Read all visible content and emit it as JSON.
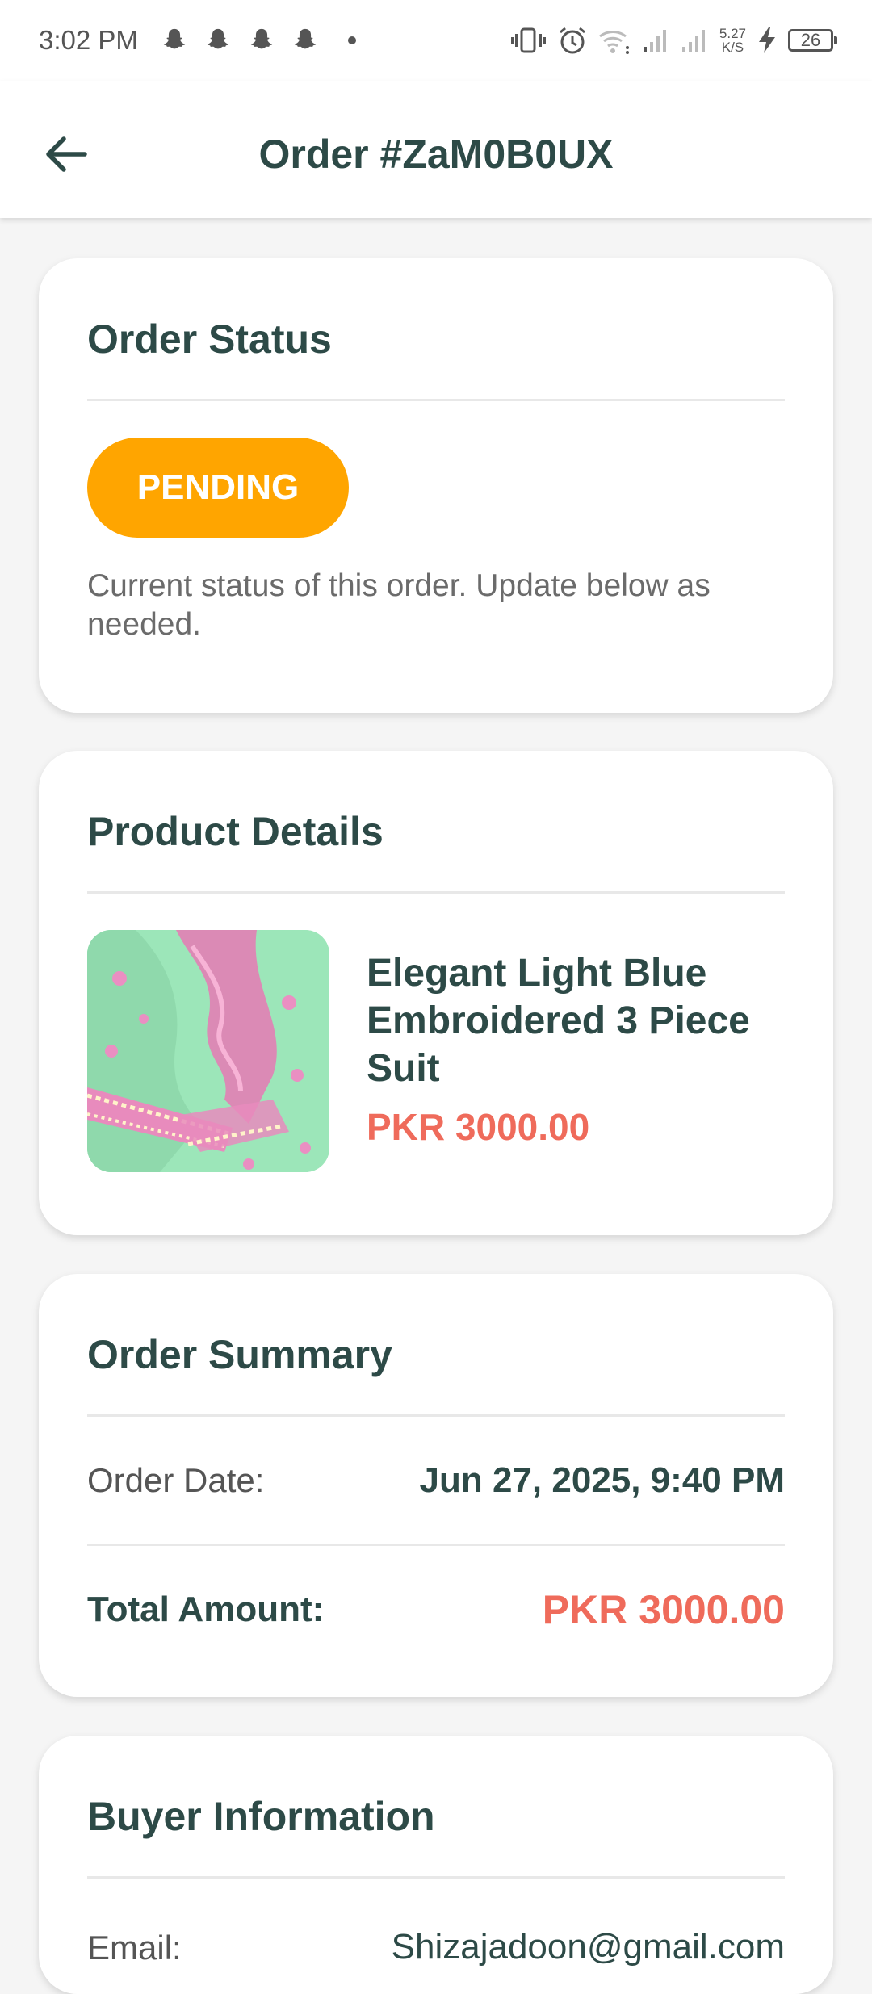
{
  "status_bar": {
    "time": "3:02 PM",
    "net_speed_value": "5.27",
    "net_speed_unit": "K/S",
    "battery": "26"
  },
  "app_bar": {
    "title": "Order #ZaM0B0UX"
  },
  "order_status": {
    "title": "Order Status",
    "badge": "PENDING",
    "badge_color": "#FFA500",
    "description": "Current status of this order. Update below as needed."
  },
  "product_details": {
    "title": "Product Details",
    "name": "Elegant Light Blue Embroidered 3 Piece Suit",
    "price": "PKR 3000.00"
  },
  "order_summary": {
    "title": "Order Summary",
    "date_label": "Order Date:",
    "date_value": "Jun 27, 2025, 9:40 PM",
    "total_label": "Total Amount:",
    "total_value": "PKR 3000.00"
  },
  "buyer_info": {
    "title": "Buyer Information",
    "email_label": "Email:",
    "email_value": "Shizajadoon@gmail.com"
  },
  "colors": {
    "primary_text": "#2D4A47",
    "accent_price": "#EF6B5B",
    "status_pending": "#FFA500"
  }
}
